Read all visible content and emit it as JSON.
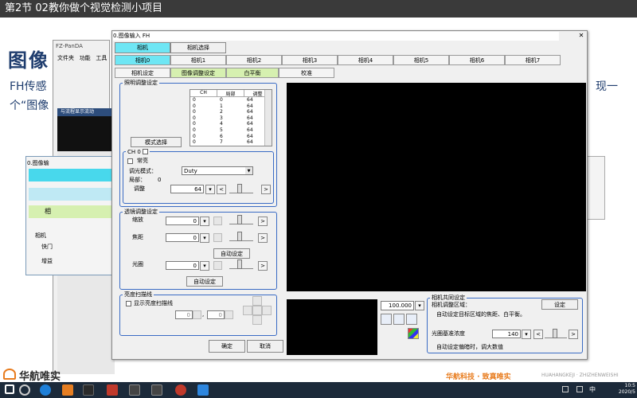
{
  "video_title": "第2节 02教你做个视觉检测小项目",
  "slide": {
    "title": "图像",
    "line1": "FH传感",
    "line2": "个“图像",
    "right_fragment": "现一",
    "logo_text": "华航唯实",
    "slogan": "华航科技 · 致真唯实",
    "slogan_small": "HUAHANGKEJI · ZHIZHENWEISHI"
  },
  "back_window": {
    "title": "FZ-PanDA",
    "menu": [
      "文件夹",
      "功能",
      "工具"
    ],
    "bar_text": "与流程显示流动"
  },
  "left_window": {
    "title": "0.图像输",
    "tab_label": "相",
    "group_label": "相机",
    "row1": "快门",
    "row2": "增益"
  },
  "dialog": {
    "title": "0.图像输入 FH",
    "close": "✕",
    "top_tabs": [
      "相机",
      "相机选择"
    ],
    "camera_tabs": [
      "相机0",
      "相机1",
      "相机2",
      "相机3",
      "相机4",
      "相机5",
      "相机6",
      "相机7"
    ],
    "sub_tabs": [
      "相机设定",
      "图像调整设定",
      "白平衡",
      "校准"
    ],
    "lighting": {
      "label": "照明调整设定",
      "mode_button": "模式选择",
      "table_headers": [
        "CH",
        "局部",
        "调整"
      ],
      "table_rows": [
        [
          "0",
          "0",
          "64"
        ],
        [
          "0",
          "1",
          "64"
        ],
        [
          "0",
          "2",
          "64"
        ],
        [
          "0",
          "3",
          "64"
        ],
        [
          "0",
          "4",
          "64"
        ],
        [
          "0",
          "5",
          "64"
        ],
        [
          "0",
          "6",
          "64"
        ],
        [
          "0",
          "7",
          "64"
        ]
      ],
      "ch_label": "CH 0",
      "always_on": "常亮",
      "dimming_mode_label": "调光模式：",
      "dimming_mode_value": "Duty",
      "local_label": "局部：",
      "local_value": "0",
      "adjust_label": "调整",
      "adjust_value": "64"
    },
    "lens": {
      "label": "透镜调整设定",
      "zoom_label": "缩放",
      "zoom_value": "0",
      "focus_label": "焦距",
      "focus_value": "0",
      "auto_button_1": "自动设定",
      "iris_label": "光圈",
      "iris_value": "0",
      "auto_button_2": "自动设定"
    },
    "brightness_scan": {
      "label": "亮度扫描线",
      "show_label": "显示亮度扫描线",
      "val1": "0",
      "val2": "0"
    },
    "zoom_value": "100.000",
    "camera_common": {
      "label": "相机共同设定",
      "region_label": "相机调整区域：",
      "set_button": "设定",
      "region_desc": "自动设定目标区域的焦距、白平衡。",
      "iris_ref_label": "光圈基准浓度",
      "iris_ref_value": "140",
      "note": "自动设定偏暗时，调大数值"
    },
    "ok_button": "确定",
    "cancel_button": "取消"
  },
  "clock": {
    "time": "10:5",
    "date": "2020/5"
  },
  "ime": "中",
  "colors": {
    "tab_cyan": "#6ee6f4",
    "tab_green": "#d6f0b0",
    "group_border": "#3a6bc4",
    "accent_orange": "#e87c1e"
  }
}
